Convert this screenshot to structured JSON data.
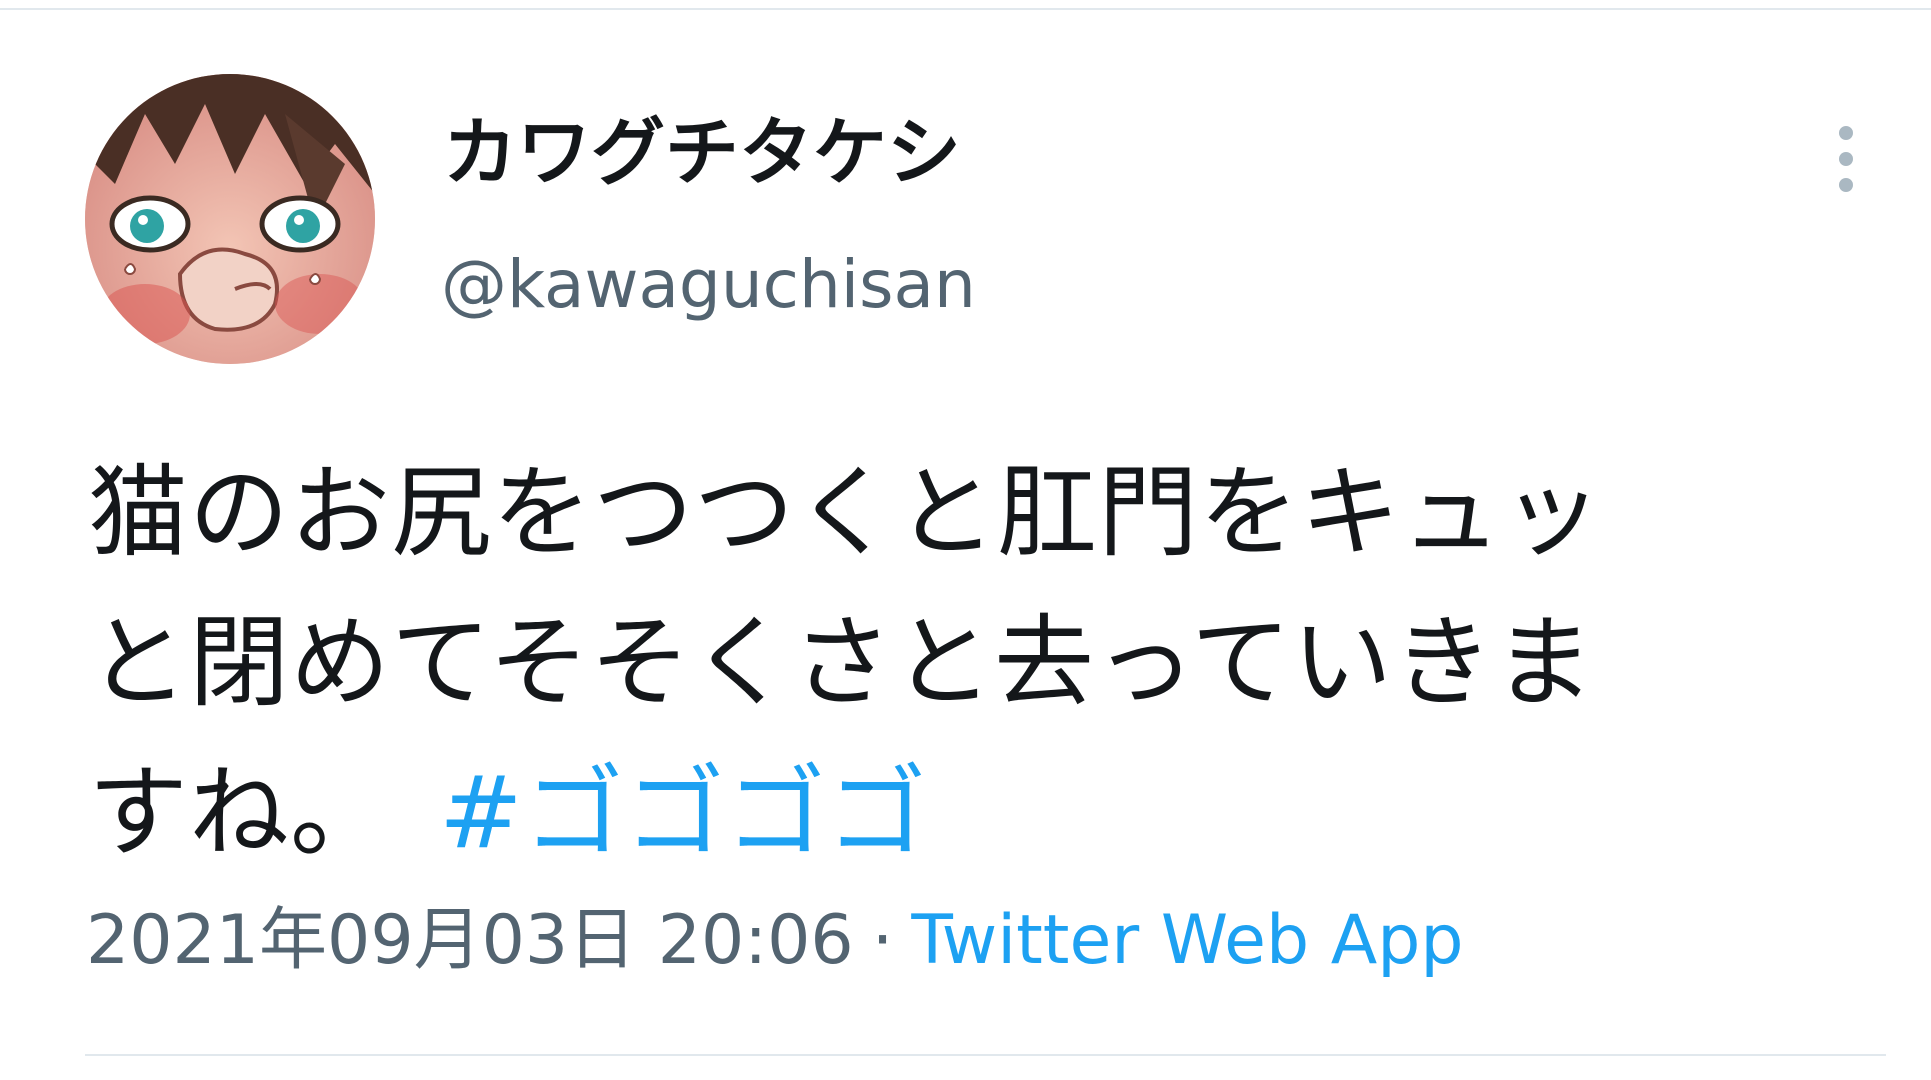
{
  "tweet": {
    "author": {
      "display_name": "カワグチタケシ",
      "handle": "@kawaguchisan"
    },
    "text_lines": [
      "猫のお尻をつつくと肛門をキュッ",
      "と閉めてそそくさと去っていきま",
      "すね。"
    ],
    "hashtag": "#ゴゴゴゴ",
    "timestamp": "2021年09月03日 20:06",
    "separator": "·",
    "source": "Twitter Web App",
    "icons": {
      "more": "more-vertical-icon",
      "avatar": "profile-avatar-illustration"
    },
    "colors": {
      "link": "#1da1f2",
      "text": "#14171a",
      "secondary": "#536471",
      "divider": "#e1e8ed"
    }
  }
}
